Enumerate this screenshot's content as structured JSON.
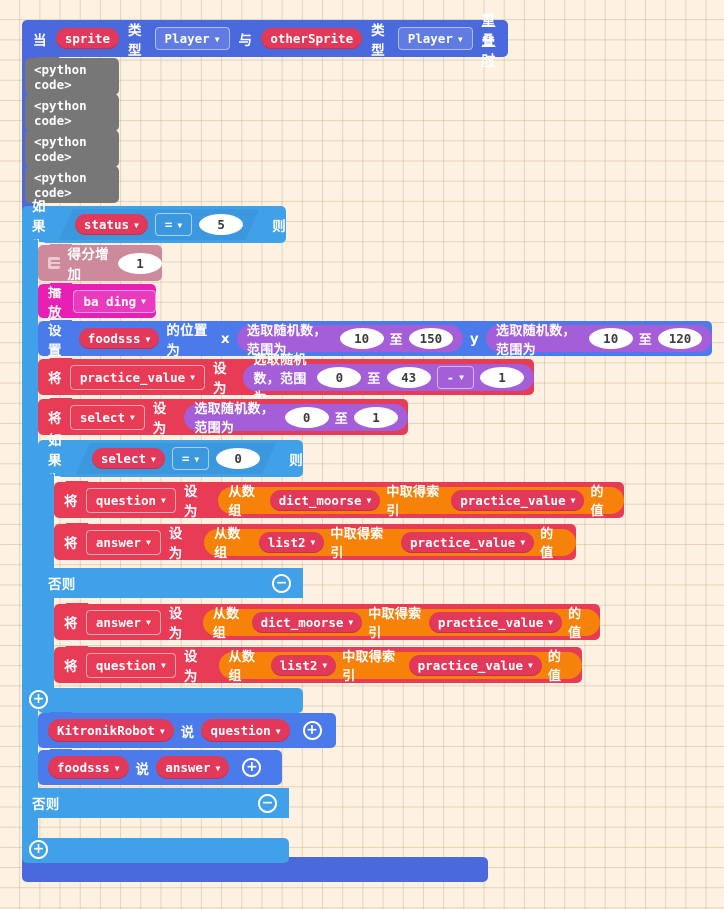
{
  "workspace": {
    "background_color": "#fdf2e2",
    "grid": true
  },
  "event_block": {
    "color": "#4a69dd",
    "label_when": "当",
    "sprite_kind_1": "sprite",
    "label_type_1": "类型",
    "kind_value_1": "Player",
    "label_and": "与",
    "sprite_kind_2": "otherSprite",
    "label_type_2": "类型",
    "kind_value_2": "Player",
    "label_overlap": "重叠时"
  },
  "python_blocks": [
    {
      "label": "<python code>"
    },
    {
      "label": "<python code>"
    },
    {
      "label": "<python code>"
    },
    {
      "label": "<python code>"
    }
  ],
  "if_outer": {
    "color": "#40a0e8",
    "if_label": "如果为",
    "then_label": "则",
    "else_label": "否则",
    "condition": {
      "left": "status",
      "operator": "=",
      "right": "5"
    },
    "else_empty": true,
    "expand_icon": "plus-circle-icon",
    "collapse_icon": "minus-circle-icon"
  },
  "score_block": {
    "color": "#cc8a9b",
    "icon": "screen-icon",
    "label": "得分增加",
    "value": "1"
  },
  "music_block": {
    "color": "#e81fb4",
    "label": "播放",
    "sound": "ba ding"
  },
  "set_position_block": {
    "color": "#4b7bea",
    "label_set": "设置",
    "sprite": "foodsss",
    "label_position": "的位置为",
    "label_x": "x",
    "label_y": "y",
    "x_random": {
      "label": "选取随机数，范围为",
      "label_to": "至",
      "min": "10",
      "max": "150"
    },
    "y_random": {
      "label": "选取随机数，范围为",
      "label_to": "至",
      "min": "10",
      "max": "120"
    }
  },
  "set_practice_value": {
    "color": "#e83b55",
    "label_set": "将",
    "variable": "practice_value",
    "label_to": "设为",
    "random": {
      "label": "选取随机数，范围为",
      "label_to": "至",
      "min": "0",
      "max": "43"
    },
    "operator": "-",
    "operand": "1"
  },
  "set_select": {
    "color": "#e83b55",
    "label_set": "将",
    "variable": "select",
    "label_to": "设为",
    "random": {
      "label": "选取随机数，范围为",
      "label_to": "至",
      "min": "0",
      "max": "1"
    }
  },
  "if_inner": {
    "color": "#40a0e8",
    "if_label": "如果为",
    "then_label": "则",
    "else_label": "否则",
    "condition": {
      "left": "select",
      "operator": "=",
      "right": "0"
    },
    "collapse_icon": "minus-circle-icon",
    "expand_icon": "plus-circle-icon"
  },
  "array_rows": [
    {
      "label_set": "将",
      "variable": "question",
      "label_to": "设为",
      "label_from_array": "从数组",
      "array": "dict_moorse",
      "label_get_index": "中取得索引",
      "index": "practice_value",
      "label_value": "的值"
    },
    {
      "label_set": "将",
      "variable": "answer",
      "label_to": "设为",
      "label_from_array": "从数组",
      "array": "list2",
      "label_get_index": "中取得索引",
      "index": "practice_value",
      "label_value": "的值"
    },
    {
      "label_set": "将",
      "variable": "answer",
      "label_to": "设为",
      "label_from_array": "从数组",
      "array": "dict_moorse",
      "label_get_index": "中取得索引",
      "index": "practice_value",
      "label_value": "的值"
    },
    {
      "label_set": "将",
      "variable": "question",
      "label_to": "设为",
      "label_from_array": "从数组",
      "array": "list2",
      "label_get_index": "中取得索引",
      "index": "practice_value",
      "label_value": "的值"
    }
  ],
  "say_rows": [
    {
      "sprite": "KitronikRobot",
      "label_say": "说",
      "text": "question",
      "add_icon": "plus-circle-icon"
    },
    {
      "sprite": "foodsss",
      "label_say": "说",
      "text": "answer",
      "add_icon": "plus-circle-icon"
    }
  ]
}
